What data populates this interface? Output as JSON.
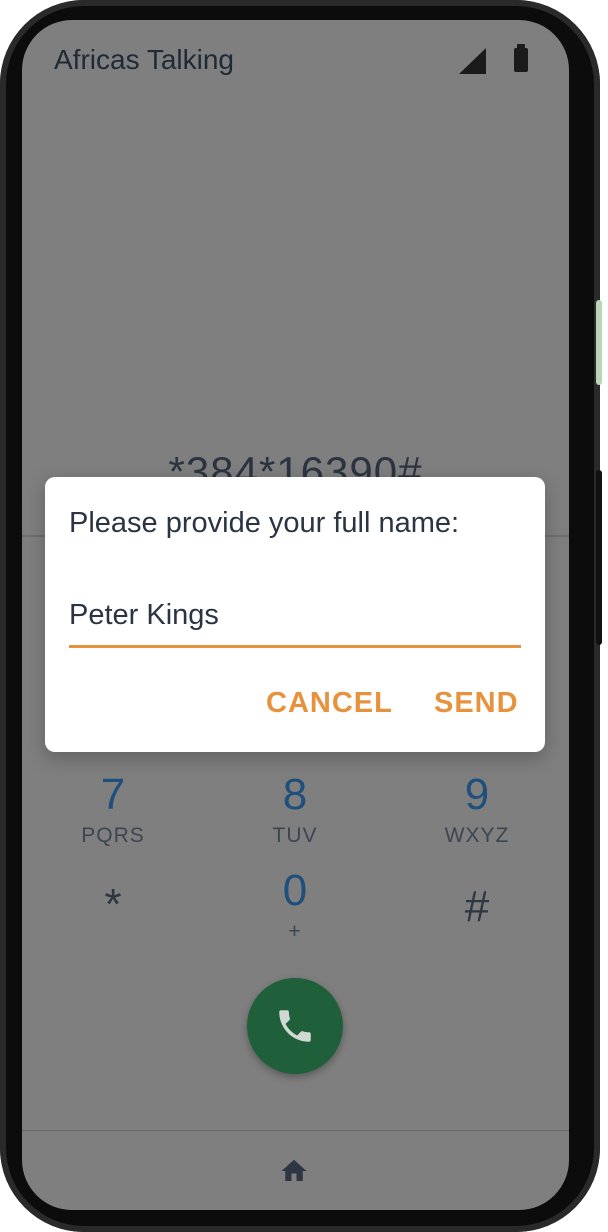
{
  "app": {
    "title": "Africas Talking"
  },
  "dial_code": "*384*16390#",
  "keypad": [
    {
      "digit": "7",
      "letters": "PQRS"
    },
    {
      "digit": "8",
      "letters": "TUV"
    },
    {
      "digit": "9",
      "letters": "WXYZ"
    },
    {
      "digit": "*",
      "letters": ""
    },
    {
      "digit": "0",
      "letters": "+"
    },
    {
      "digit": "#",
      "letters": ""
    }
  ],
  "dialog": {
    "prompt": "Please provide your full name:",
    "input_value": "Peter Kings",
    "cancel_label": "CANCEL",
    "send_label": "SEND"
  },
  "colors": {
    "accent": "#e8923e",
    "call_button": "#1f5f3a",
    "scrim": "#7f7f7f",
    "keypad_digit": "#1f4f7a"
  },
  "icons": {
    "status": [
      "signal-icon",
      "battery-icon"
    ],
    "call": "phone-icon",
    "nav": "home-icon"
  }
}
